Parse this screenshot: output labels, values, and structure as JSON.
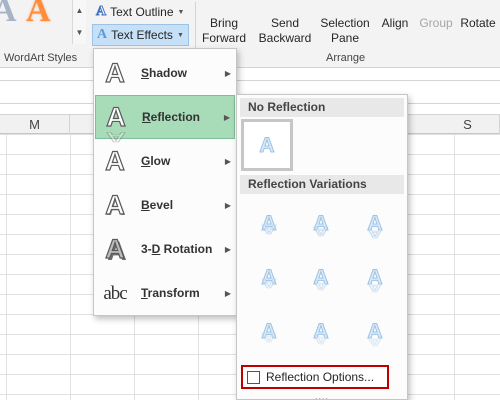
{
  "ribbon": {
    "wordart_group_label": "WordArt Styles",
    "arrange_group_label": "Arrange",
    "text_outline_label": "Text Outline",
    "text_effects_label": "Text Effects",
    "bring_forward": [
      "Bring",
      "Forward"
    ],
    "send_backward": [
      "Send",
      "Backward"
    ],
    "selection_pane": [
      "Selection",
      "Pane"
    ],
    "align": "Align",
    "group": "Group",
    "rotate": "Rotate"
  },
  "grid": {
    "column_headers": [
      "M",
      "S"
    ]
  },
  "text_effects_menu": {
    "items": [
      {
        "label": "Shadow",
        "icon": "shadow-effect-icon",
        "accelerator": "S"
      },
      {
        "label": "Reflection",
        "icon": "reflection-effect-icon",
        "accelerator": "R",
        "active": true
      },
      {
        "label": "Glow",
        "icon": "glow-effect-icon",
        "accelerator": "G"
      },
      {
        "label": "Bevel",
        "icon": "bevel-effect-icon",
        "accelerator": "B"
      },
      {
        "label": "3-D Rotation",
        "icon": "3d-rotation-effect-icon",
        "accelerator": "D"
      },
      {
        "label": "Transform",
        "icon": "transform-effect-icon",
        "accelerator": "T"
      }
    ]
  },
  "reflection_submenu": {
    "no_reflection_header": "No Reflection",
    "variations_header": "Reflection Variations",
    "options_label": "Reflection Options...",
    "grip": "...."
  },
  "colors": {
    "active_item_bg": "#a8dbb8",
    "text_effects_button_bg": "#c5e0f7",
    "highlight_border": "#c00000"
  }
}
